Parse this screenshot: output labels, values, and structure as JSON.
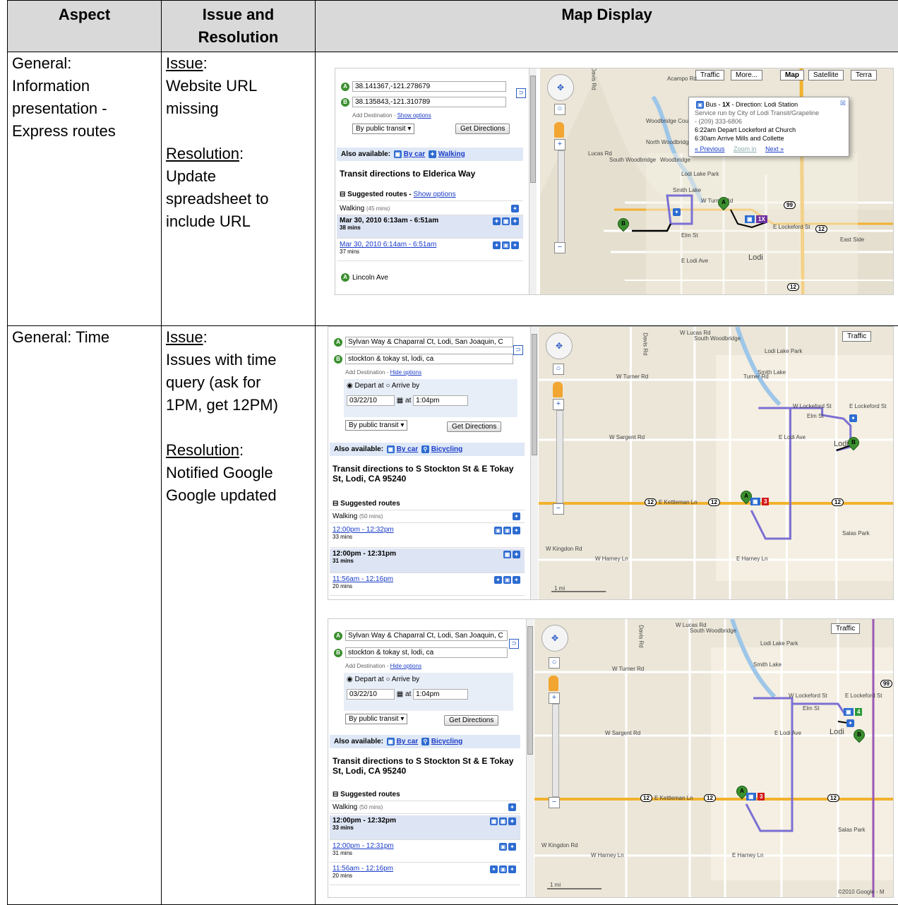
{
  "table": {
    "headers": [
      "Aspect",
      "Issue and Resolution",
      "Map Display"
    ],
    "rows": [
      {
        "aspect": [
          "General:",
          "Information",
          "presentation -",
          "Express routes"
        ],
        "issue_label": "Issue",
        "issue_text": [
          "Website URL",
          "missing"
        ],
        "resolution_label": "Resolution",
        "resolution_text": [
          "Update",
          "spreadsheet to",
          "include URL"
        ]
      },
      {
        "aspect": [
          "General: Time"
        ],
        "issue_label": "Issue",
        "issue_text": [
          "Issues with time",
          "query (ask for",
          "1PM, get 12PM)"
        ],
        "resolution_label": "Resolution",
        "resolution_text": [
          "Notified Google",
          "Google updated"
        ]
      }
    ]
  },
  "shot1": {
    "a": "38.141367,-121.278679",
    "b": "38.135843,-121.310789",
    "add_dest": "Add Destination - ",
    "show_options": "Show options",
    "mode": "By public transit",
    "get_directions": "Get Directions",
    "also_available": "Also available:",
    "by_car": "By car",
    "walking": "Walking",
    "heading": "Transit directions to Elderica Way",
    "suggested": "Suggested routes - ",
    "walking_row": "Walking",
    "walking_time": "(45 mins)",
    "routes": [
      {
        "label": "Mar 30, 2010 6:13am - 6:51am",
        "mins": "38 mins"
      },
      {
        "label": "Mar 30, 2010 6:14am - 6:51am",
        "mins": "37 mins"
      }
    ],
    "start_label": "Lincoln Ave",
    "map_tabs": [
      "Traffic",
      "More...",
      "Map",
      "Satellite",
      "Terra"
    ],
    "popup": {
      "title_pre": "Bus - ",
      "title_bold": "1X",
      "title_post": " - Direction: Lodi Station",
      "service": "Service run by City of Lodi Transit/Grapeline",
      "phone": "- (209) 333-6806",
      "depart": "6:22am Depart Lockeford at Church",
      "arrive": "6:30am Arrive Mills and Collette",
      "prev": "« Previous",
      "zoom": "Zoom in",
      "next": "Next »"
    },
    "labels": [
      "Acampo Rd",
      "Woodbridge Country Club",
      "North Woodbridge",
      "South Woodbridge",
      "Woodbridge",
      "Lodi Lake Park",
      "Smith Lake",
      "W Turner Rd",
      "Elm St",
      "E Lockeford St",
      "East Side",
      "Lodi",
      "E Lodi Ave",
      "Lucas Rd",
      "Davis Rd"
    ],
    "hwy": [
      "99",
      "12",
      "12"
    ],
    "bus_badge": "1X"
  },
  "shot2": {
    "a": "Sylvan Way & Chaparral Ct, Lodi, San Joaquin, C",
    "b": "stockton & tokay st, lodi, ca",
    "add_dest": "Add Destination - ",
    "hide_options": "Hide options",
    "depart_at": "Depart at",
    "arrive_by": "Arrive by",
    "date": "03/22/10",
    "at": "at",
    "time": "1:04pm",
    "mode": "By public transit",
    "get_directions": "Get Directions",
    "also_available": "Also available:",
    "by_car": "By car",
    "bicycling": "Bicycling",
    "heading": "Transit directions to S Stockton St & E Tokay St, Lodi, CA 95240",
    "suggested": "Suggested routes",
    "walking_row": "Walking",
    "walking_time": "(50 mins)",
    "routes": [
      {
        "label": "12:00pm - 12:32pm",
        "mins": "33 mins"
      },
      {
        "label": "12:00pm - 12:31pm",
        "mins": "31 mins"
      },
      {
        "label": "11:56am - 12:16pm",
        "mins": "20 mins"
      }
    ],
    "map_tabs": [
      "Traffic"
    ],
    "labels": [
      "W Lucas Rd",
      "South Woodbridge",
      "Lodi Lake Park",
      "Smith Lake",
      "W Turner Rd",
      "Turner Rd",
      "W Lockeford St",
      "E Lockeford St",
      "Elm St",
      "E Lodi Ave",
      "W Sargent Rd",
      "E Kettleman Ln",
      "W Kingdon Rd",
      "W Harney Ln",
      "E Harney Ln",
      "Salas Park",
      "Davis Rd",
      "Lodi",
      "1 mi"
    ],
    "hwy": [
      "12",
      "12",
      "12"
    ],
    "bus_badge": "3"
  },
  "shot3": {
    "routes": [
      {
        "label": "12:00pm - 12:32pm",
        "mins": "33 mins"
      },
      {
        "label": "12:00pm - 12:31pm",
        "mins": "31 mins"
      },
      {
        "label": "11:56am - 12:16pm",
        "mins": "20 mins"
      }
    ],
    "bus_badges": [
      "4",
      "3"
    ],
    "hwy": [
      "12",
      "12",
      "12",
      "99"
    ],
    "copyright": "©2010 Google - M"
  },
  "colors": {
    "header_bg": "#d9d9d9",
    "link": "#1a3cc8",
    "route_line": "#7b6fd3",
    "panel_sel": "#dde4f3",
    "map_bg": "#efeadf"
  }
}
